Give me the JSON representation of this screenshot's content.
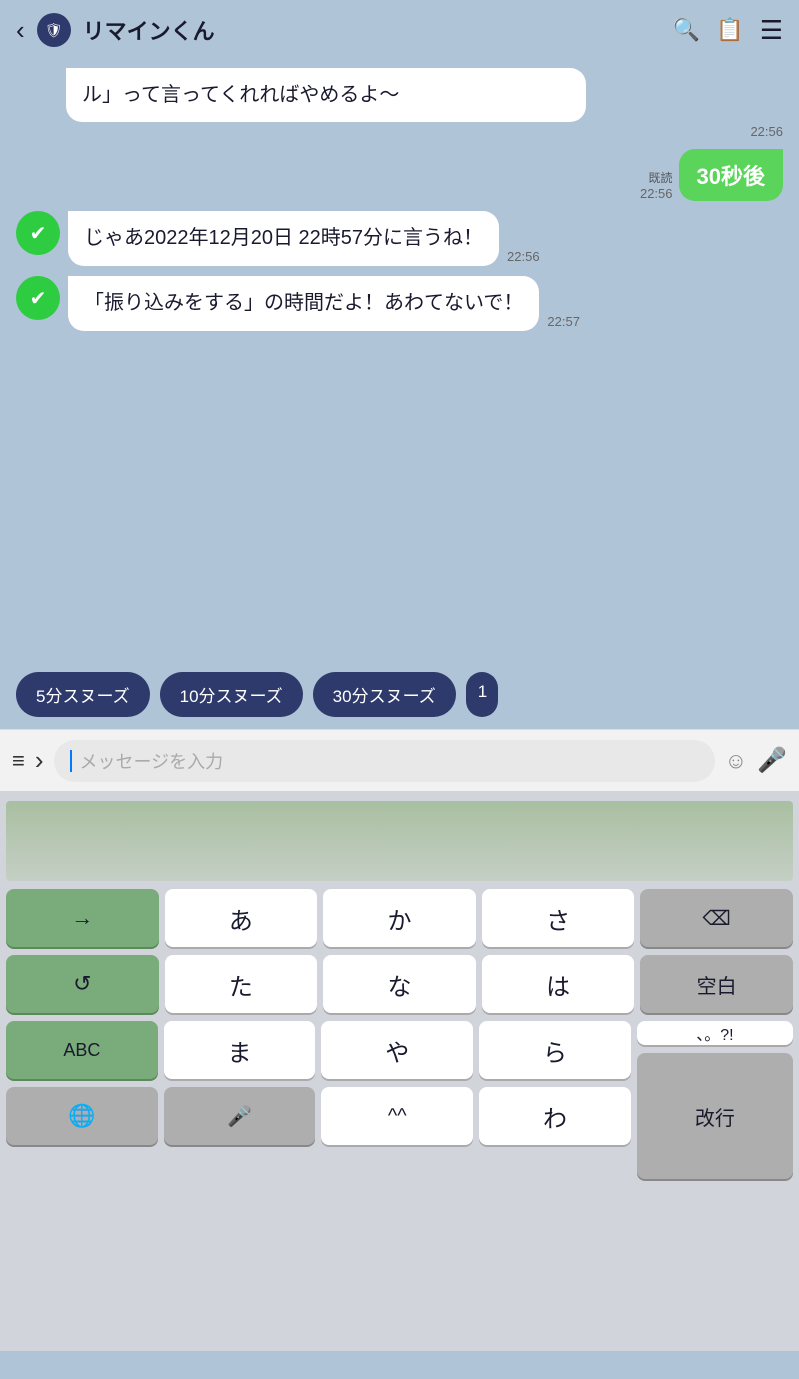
{
  "header": {
    "back_label": "‹",
    "icon_symbol": "🛡",
    "title": "リマインくん",
    "search_label": "🔍",
    "list_label": "≡",
    "menu_label": "☰"
  },
  "chat": {
    "msg1": {
      "text": "ル」って言ってくれればやめるよ〜",
      "time": "22:56"
    },
    "msg2": {
      "read_label": "既読",
      "time": "22:56",
      "text": "30秒後"
    },
    "msg3": {
      "text": "じゃあ2022年12月20日 22時57分に言うね！",
      "time": "22:56"
    },
    "msg4": {
      "text": "「振り込みをする」の時間だよ！あわてないで！",
      "time": "22:57"
    }
  },
  "snooze": {
    "btn1": "5分スヌーズ",
    "btn2": "10分スヌーズ",
    "btn3": "30分スヌーズ",
    "btn4": "1"
  },
  "input": {
    "menu_icon": "≡",
    "arrow_icon": "›",
    "placeholder": "メッセージを入力",
    "emoji_icon": "☺",
    "mic_icon": "🎤"
  },
  "keyboard": {
    "row1": [
      "→",
      "あ",
      "か",
      "さ",
      "⌫"
    ],
    "row2": [
      "↺",
      "た",
      "な",
      "は",
      "空白"
    ],
    "row3": [
      "ABC",
      "ま",
      "や",
      "ら",
      "改行"
    ],
    "row4": [
      "🌐",
      "🎤",
      "^^",
      "わ",
      "、。?!",
      "改行"
    ]
  }
}
